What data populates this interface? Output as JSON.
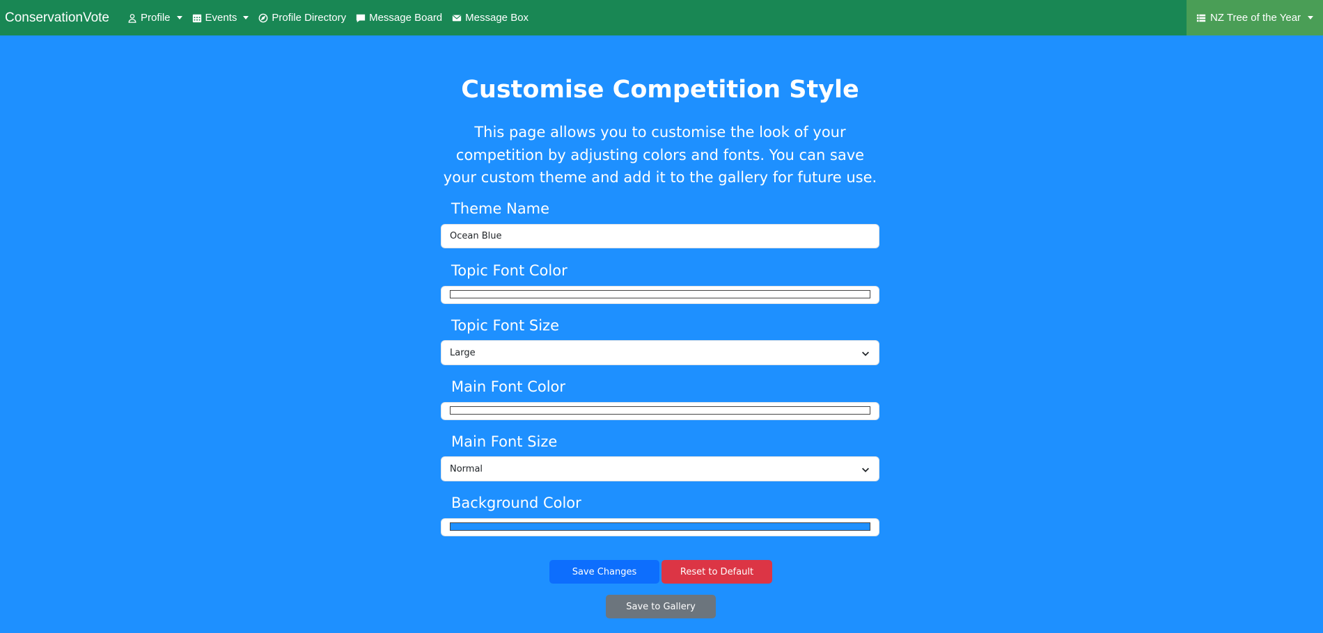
{
  "navbar": {
    "brand": "ConservationVote",
    "items": [
      {
        "label": "Profile",
        "icon": "user-icon",
        "dropdown": true
      },
      {
        "label": "Events",
        "icon": "calendar-icon",
        "dropdown": true
      },
      {
        "label": "Profile Directory",
        "icon": "compass-icon",
        "dropdown": false
      },
      {
        "label": "Message Board",
        "icon": "chat-icon",
        "dropdown": false
      },
      {
        "label": "Message Box",
        "icon": "envelope-icon",
        "dropdown": false
      }
    ],
    "right_label": "NZ Tree of the Year",
    "color": "#198754",
    "right_color": "#4a9e56"
  },
  "page": {
    "title": "Customise Competition Style",
    "intro": "This page allows you to customise the look of your competition by adjusting colors and fonts. You can save your custom theme and add it to the gallery for future use.",
    "background": "#1e90ff"
  },
  "form": {
    "theme_name_label": "Theme Name",
    "theme_name_value": "Ocean Blue",
    "topic_font_color_label": "Topic Font Color",
    "topic_font_color_value": "#ffffff",
    "topic_font_size_label": "Topic Font Size",
    "topic_font_size_value": "Large",
    "main_font_color_label": "Main Font Color",
    "main_font_color_value": "#ffffff",
    "main_font_size_label": "Main Font Size",
    "main_font_size_value": "Normal",
    "background_color_label": "Background Color",
    "background_color_value": "#1e90ff"
  },
  "buttons": {
    "save": "Save Changes",
    "save_color": "#0d6efd",
    "reset": "Reset to Default",
    "reset_color": "#dc3545",
    "gallery": "Save to Gallery",
    "gallery_color": "#6c757d"
  }
}
